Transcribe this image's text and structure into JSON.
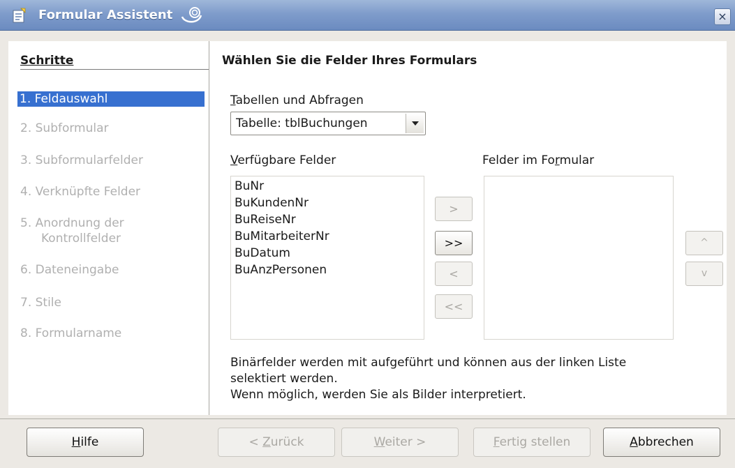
{
  "window": {
    "title": "Formular Assistent",
    "close_glyph": "×"
  },
  "sidebar": {
    "heading": "Schritte",
    "steps": [
      {
        "label": "1. Feldauswahl",
        "active": true
      },
      {
        "label": "2. Subformular",
        "active": false
      },
      {
        "label": "3. Subformularfelder",
        "active": false
      },
      {
        "label": "4. Verknüpfte Felder",
        "active": false
      },
      {
        "label": "5. Anordnung der",
        "label2": "Kontrollfelder",
        "active": false
      },
      {
        "label": "6. Dateneingabe",
        "active": false
      },
      {
        "label": "7. Stile",
        "active": false
      },
      {
        "label": "8. Formularname",
        "active": false
      }
    ]
  },
  "main": {
    "title": "Wählen Sie die Felder Ihres Formulars",
    "tables_label_first": "T",
    "tables_label_rest": "abellen und Abfragen",
    "tables_value": "Tabelle: tblBuchungen",
    "available_label_first": "V",
    "available_label_rest": "erfügbare Felder",
    "form_fields_label_a": "Felder im Fo",
    "form_fields_label_u": "r",
    "form_fields_label_b": "mular",
    "available_fields": [
      "BuNr",
      "BuKundenNr",
      "BuReiseNr",
      "BuMitarbeiterNr",
      "BuDatum",
      "BuAnzPersonen"
    ],
    "move_buttons": {
      "add_one": ">",
      "add_all": ">>",
      "remove_one": "<",
      "remove_all": "<<"
    },
    "sort_buttons": {
      "up": "^",
      "down": "v"
    },
    "info_lines": [
      "Binärfelder werden mit aufgeführt und können aus der linken Liste",
      "selektiert werden.",
      "Wenn möglich, werden Sie als Bilder interpretiert."
    ]
  },
  "footer": {
    "help_u": "H",
    "help_rest": "ilfe",
    "back_pre": "< ",
    "back_u": "Z",
    "back_rest": "urück",
    "next_u": "W",
    "next_rest": "eiter >",
    "finish_u": "F",
    "finish_rest": "ertig stellen",
    "cancel_u": "A",
    "cancel_rest": "bbrechen"
  },
  "colors": {
    "titlebar": "#7f9ccb",
    "selection": "#3770d0",
    "disabled_text": "#b0b0b0"
  },
  "icons": {
    "app": "form-wizard-icon",
    "title_decoration": "swirl-icon",
    "close": "close-icon",
    "dropdown": "chevron-down-icon"
  }
}
